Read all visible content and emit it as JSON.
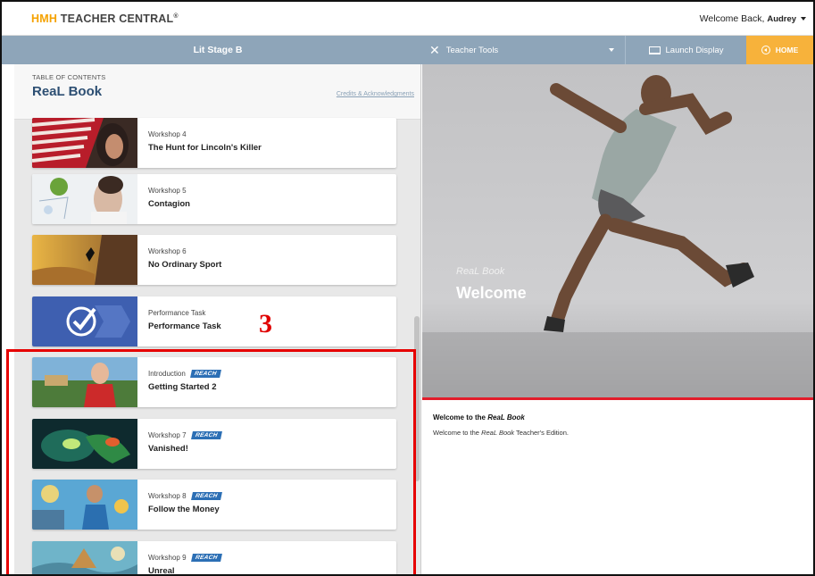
{
  "header": {
    "brand_hmh": "HMH",
    "brand_rest": "TEACHER CENTRAL",
    "brand_tm": "®",
    "welcome_text": "Welcome Back, ",
    "user_name": "Audrey"
  },
  "nav": {
    "stage_title": "Lit Stage B",
    "teacher_tools_label": "Teacher Tools",
    "launch_display_label": "Launch Display",
    "home_label": "HOME"
  },
  "toc": {
    "section_label": "TABLE OF CONTENTS",
    "book_title": "ReaL Book",
    "credits_link": "Credits & Acknowledgments",
    "reach_badge": "REACH",
    "items": [
      {
        "subtitle": "Workshop 4",
        "title": "The Hunt for Lincoln's Killer",
        "reach": false
      },
      {
        "subtitle": "Workshop 5",
        "title": "Contagion",
        "reach": false
      },
      {
        "subtitle": "Workshop 6",
        "title": "No Ordinary Sport",
        "reach": false
      },
      {
        "subtitle": "Performance Task",
        "title": "Performance Task",
        "reach": false
      },
      {
        "subtitle": "Introduction",
        "title": "Getting Started 2",
        "reach": true
      },
      {
        "subtitle": "Workshop 7",
        "title": "Vanished!",
        "reach": true
      },
      {
        "subtitle": "Workshop 8",
        "title": "Follow the Money",
        "reach": true
      },
      {
        "subtitle": "Workshop 9",
        "title": "Unreal",
        "reach": true
      }
    ]
  },
  "annotation": {
    "number": "3",
    "color": "#e60000"
  },
  "hero": {
    "subtitle": "ReaL Book",
    "title": "Welcome"
  },
  "intro": {
    "title_prefix": "Welcome to the ",
    "title_book": "ReaL Book",
    "text_prefix": "Welcome to the ",
    "text_book": "ReaL Book",
    "text_suffix": " Teacher's Edition."
  },
  "colors": {
    "nav_bg": "#8ea5b9",
    "home_bg": "#f7b23b",
    "brand_accent": "#f5a200",
    "title_blue": "#2d4f73",
    "reach_blue": "#2c6fb5",
    "hero_accent": "#e21d2b"
  },
  "icons": {
    "tools": "tools-icon",
    "display": "monitor-icon",
    "home": "home-circle-icon",
    "dropdown": "chevron-down-icon"
  }
}
